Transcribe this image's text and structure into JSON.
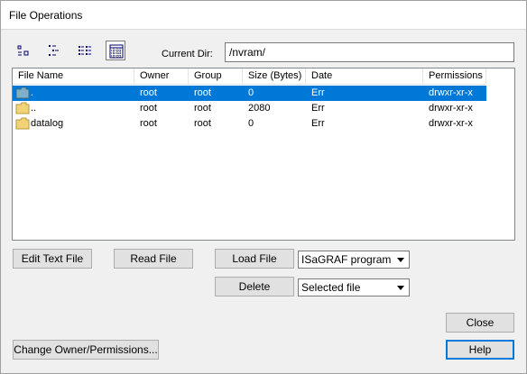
{
  "window": {
    "title": "File Operations"
  },
  "toolbar": {
    "buttons": [
      {
        "name": "large-icons-view"
      },
      {
        "name": "small-icons-view"
      },
      {
        "name": "list-view"
      },
      {
        "name": "details-view"
      }
    ]
  },
  "current_dir": {
    "label": "Current Dir:",
    "value": "/nvram/"
  },
  "file_list": {
    "columns": [
      "File Name",
      "Owner",
      "Group",
      "Size (Bytes)",
      "Date",
      "Permissions"
    ],
    "rows": [
      {
        "name": ".",
        "owner": "root",
        "group": "root",
        "size": "0",
        "date": "Err",
        "permissions": "drwxr-xr-x",
        "selected": true
      },
      {
        "name": "..",
        "owner": "root",
        "group": "root",
        "size": "2080",
        "date": "Err",
        "permissions": "drwxr-xr-x",
        "selected": false
      },
      {
        "name": "datalog",
        "owner": "root",
        "group": "root",
        "size": "0",
        "date": "Err",
        "permissions": "drwxr-xr-x",
        "selected": false
      }
    ]
  },
  "buttons": {
    "edit_text_file": "Edit Text File",
    "read_file": "Read File",
    "load_file": "Load File",
    "delete": "Delete",
    "close": "Close",
    "help": "Help",
    "change_owner": "Change Owner/Permissions..."
  },
  "combos": {
    "load_type": "ISaGRAF program",
    "delete_scope": "Selected file"
  }
}
